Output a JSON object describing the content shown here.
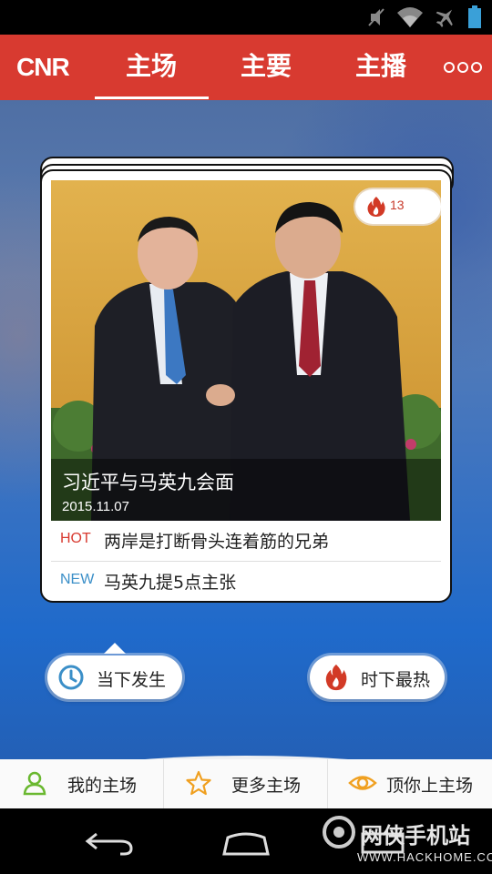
{
  "header": {
    "logo": "CNR",
    "tabs": [
      {
        "label": "主场",
        "active": true
      },
      {
        "label": "主要",
        "active": false
      },
      {
        "label": "主播",
        "active": false
      }
    ]
  },
  "card": {
    "title": "习近平与马英九会面",
    "date": "2015.11.07",
    "hot_count": "13",
    "news": [
      {
        "tag": "HOT",
        "text": "两岸是打断骨头连着筋的兄弟",
        "tag_color": "#d83a30"
      },
      {
        "tag": "NEW",
        "text": "马英九提5点主张",
        "tag_color": "#3b8fc8"
      }
    ]
  },
  "filters": {
    "latest_label": "当下发生",
    "hottest_label": "时下最热"
  },
  "bottom_nav": {
    "items": [
      {
        "label": "我的主场",
        "icon": "user-icon"
      },
      {
        "label": "更多主场",
        "icon": "star-icon"
      },
      {
        "label": "顶你上主场",
        "icon": "eye-icon"
      }
    ]
  },
  "watermark": {
    "line1": "网侠手机站",
    "line2": "WWW.HACKHOME.COM"
  },
  "colors": {
    "brand_red": "#d83a30",
    "hot_tag": "#d83a30",
    "new_tag": "#3b8fc8",
    "clock_blue": "#3b8fc8",
    "star_orange": "#f0a020",
    "user_green": "#6ab830"
  }
}
